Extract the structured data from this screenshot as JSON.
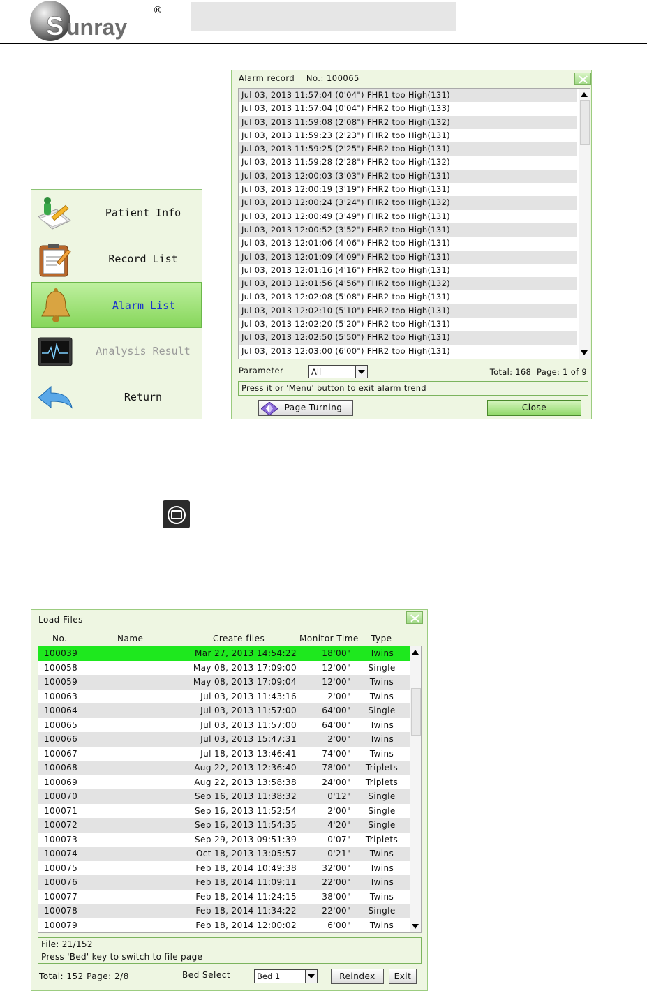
{
  "header": {
    "logo_text": "Sunray",
    "registered_mark": "®"
  },
  "menu": {
    "items": [
      {
        "label": "Patient Info",
        "icon": "patient-info-icon",
        "state": "normal"
      },
      {
        "label": "Record List",
        "icon": "clipboard-icon",
        "state": "normal"
      },
      {
        "label": "Alarm List",
        "icon": "bell-icon",
        "state": "selected"
      },
      {
        "label": "Analysis Result",
        "icon": "monitor-waveform-icon",
        "state": "disabled"
      },
      {
        "label": "Return",
        "icon": "return-arrow-icon",
        "state": "normal"
      }
    ]
  },
  "alarm_dialog": {
    "title": "Alarm record    No.: 100065",
    "rows": [
      "Jul 03, 2013 11:57:04 (0'04\") FHR1 too High(131)",
      "Jul 03, 2013 11:57:04 (0'04\") FHR2 too High(133)",
      "Jul 03, 2013 11:59:08 (2'08\") FHR2 too High(132)",
      "Jul 03, 2013 11:59:23 (2'23\") FHR2 too High(131)",
      "Jul 03, 2013 11:59:25 (2'25\") FHR2 too High(131)",
      "Jul 03, 2013 11:59:28 (2'28\") FHR2 too High(132)",
      "Jul 03, 2013 12:00:03 (3'03\") FHR2 too High(131)",
      "Jul 03, 2013 12:00:19 (3'19\") FHR2 too High(131)",
      "Jul 03, 2013 12:00:24 (3'24\") FHR2 too High(132)",
      "Jul 03, 2013 12:00:49 (3'49\") FHR2 too High(131)",
      "Jul 03, 2013 12:00:52 (3'52\") FHR2 too High(131)",
      "Jul 03, 2013 12:01:06 (4'06\") FHR2 too High(131)",
      "Jul 03, 2013 12:01:09 (4'09\") FHR2 too High(131)",
      "Jul 03, 2013 12:01:16 (4'16\") FHR2 too High(131)",
      "Jul 03, 2013 12:01:56 (4'56\") FHR2 too High(132)",
      "Jul 03, 2013 12:02:08 (5'08\") FHR2 too High(131)",
      "Jul 03, 2013 12:02:10 (5'10\") FHR2 too High(131)",
      "Jul 03, 2013 12:02:20 (5'20\") FHR2 too High(131)",
      "Jul 03, 2013 12:02:50 (5'50\") FHR2 too High(131)",
      "Jul 03, 2013 12:03:00 (6'00\") FHR2 too High(131)"
    ],
    "parameter_label": "Parameter",
    "parameter_value": "All",
    "total_text": "Total: 168  Page: 1 of 9",
    "hint": "Press it or 'Menu' button to exit alarm trend",
    "page_turning_label": "Page Turning",
    "close_label": "Close"
  },
  "load_dialog": {
    "title": "Load Files",
    "columns": {
      "no": "No.",
      "name": "Name",
      "create": "Create files",
      "monitor": "Monitor Time",
      "type": "Type"
    },
    "rows": [
      {
        "no": "100039",
        "date": "Mar 27, 2013 14:54:22",
        "time": "18'00\"",
        "type": "Twins"
      },
      {
        "no": "100058",
        "date": "May 08, 2013 17:09:00",
        "time": "12'00\"",
        "type": "Single"
      },
      {
        "no": "100059",
        "date": "May 08, 2013 17:09:04",
        "time": "12'00\"",
        "type": "Twins"
      },
      {
        "no": "100063",
        "date": "Jul 03, 2013 11:43:16",
        "time": "2'00\"",
        "type": "Twins"
      },
      {
        "no": "100064",
        "date": "Jul 03, 2013 11:57:00",
        "time": "64'00\"",
        "type": "Single"
      },
      {
        "no": "100065",
        "date": "Jul 03, 2013 11:57:00",
        "time": "64'00\"",
        "type": "Twins"
      },
      {
        "no": "100066",
        "date": "Jul 03, 2013 15:47:31",
        "time": "2'00\"",
        "type": "Twins"
      },
      {
        "no": "100067",
        "date": "Jul 18, 2013 13:46:41",
        "time": "74'00\"",
        "type": "Twins"
      },
      {
        "no": "100068",
        "date": "Aug 22, 2013 12:36:40",
        "time": "78'00\"",
        "type": "Triplets"
      },
      {
        "no": "100069",
        "date": "Aug 22, 2013 13:58:38",
        "time": "24'00\"",
        "type": "Triplets"
      },
      {
        "no": "100070",
        "date": "Sep 16, 2013 11:38:32",
        "time": "0'12\"",
        "type": "Single"
      },
      {
        "no": "100071",
        "date": "Sep 16, 2013 11:52:54",
        "time": "2'00\"",
        "type": "Single"
      },
      {
        "no": "100072",
        "date": "Sep 16, 2013 11:54:35",
        "time": "4'20\"",
        "type": "Single"
      },
      {
        "no": "100073",
        "date": "Sep 29, 2013 09:51:39",
        "time": "0'07\"",
        "type": "Triplets"
      },
      {
        "no": "100074",
        "date": "Oct 18, 2013 13:05:57",
        "time": "0'21\"",
        "type": "Twins"
      },
      {
        "no": "100075",
        "date": "Feb 18, 2014 10:49:38",
        "time": "32'00\"",
        "type": "Twins"
      },
      {
        "no": "100076",
        "date": "Feb 18, 2014 11:09:11",
        "time": "22'00\"",
        "type": "Twins"
      },
      {
        "no": "100077",
        "date": "Feb 18, 2014 11:24:15",
        "time": "38'00\"",
        "type": "Twins"
      },
      {
        "no": "100078",
        "date": "Feb 18, 2014 11:34:22",
        "time": "22'00\"",
        "type": "Single"
      },
      {
        "no": "100079",
        "date": "Feb 18, 2014 12:00:02",
        "time": "6'00\"",
        "type": "Twins"
      }
    ],
    "status_line1": "File: 21/152",
    "status_line2": "Press 'Bed' key to switch to file page",
    "total_text": "Total: 152 Page: 2/8",
    "bed_select_label": "Bed Select",
    "bed_value": "Bed 1",
    "reindex_label": "Reindex",
    "exit_label": "Exit"
  },
  "colors": {
    "dialog_bg": "#eef6e2",
    "selected_row": "#1ee81e",
    "selected_menu_text": "#1a33cc",
    "accent_green": "#8fd868"
  }
}
